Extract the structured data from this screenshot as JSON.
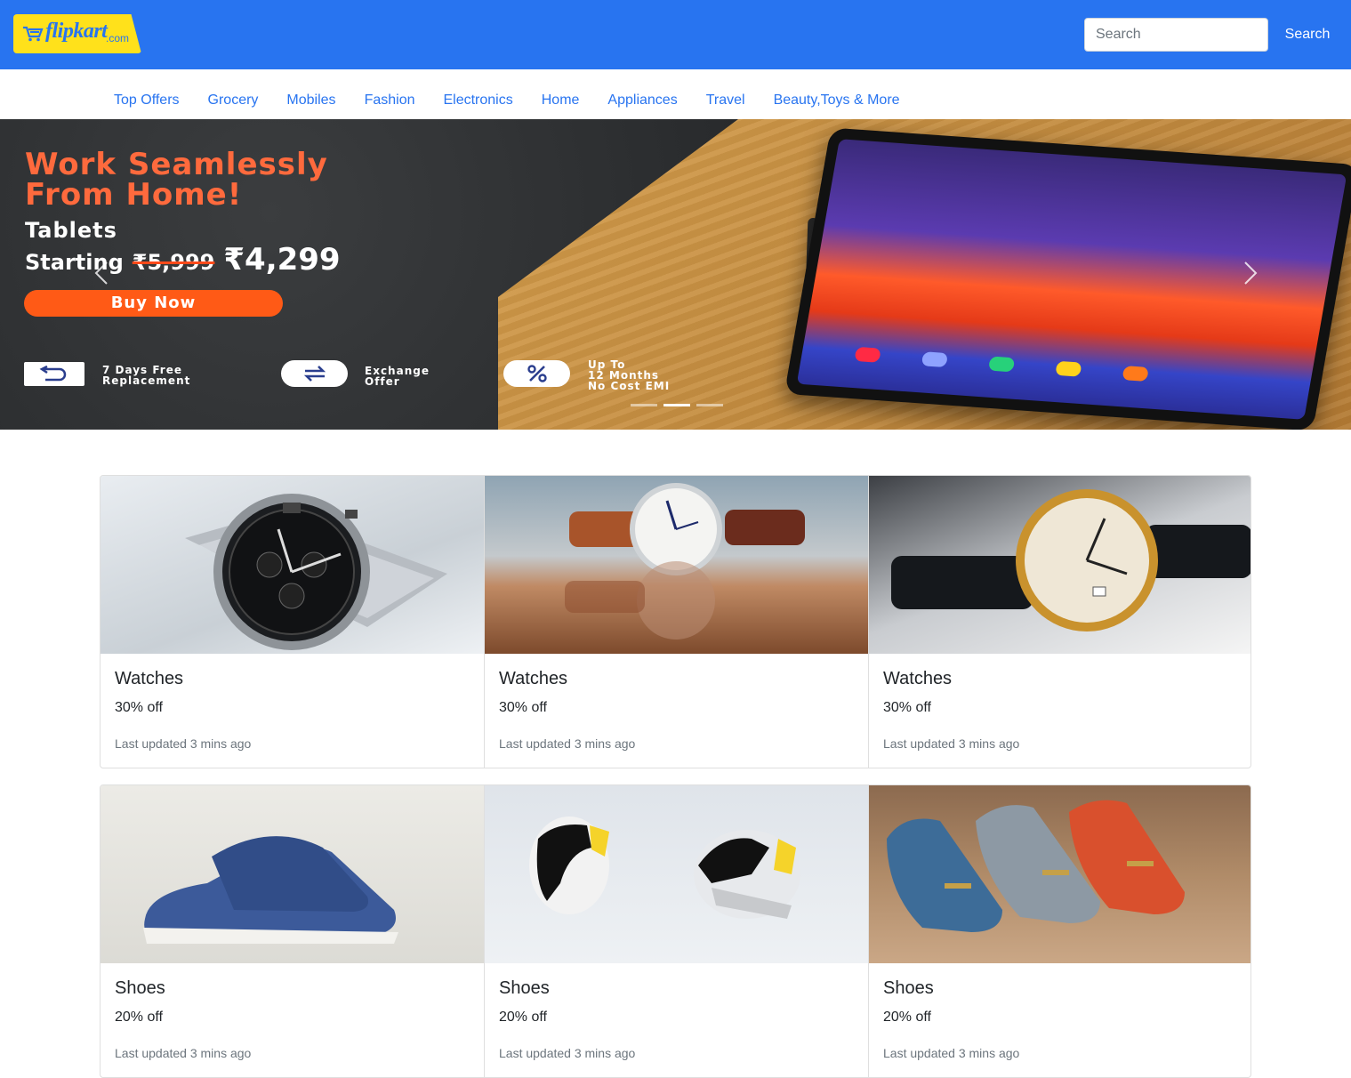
{
  "header": {
    "logo_text": "flipkart",
    "logo_suffix": ".com",
    "search_placeholder": "Search",
    "search_button": "Search",
    "colors": {
      "brand_blue": "#2874f0",
      "logo_yellow": "#ffe11b"
    }
  },
  "nav": {
    "categories": [
      "Top Offers",
      "Grocery",
      "Mobiles",
      "Fashion",
      "Electronics",
      "Home",
      "Appliances",
      "Travel",
      "Beauty,Toys & More"
    ]
  },
  "banner": {
    "headline_line1": "Work Seamlessly",
    "headline_line2": "From Home!",
    "product": "Tablets",
    "starting_label": "Starting",
    "old_price": "₹5,999",
    "new_price": "₹4,299",
    "cta": "Buy Now",
    "features": [
      {
        "icon": "return-icon",
        "line1": "7 Days Free",
        "line2": "Replacement"
      },
      {
        "icon": "exchange-icon",
        "line1": "Exchange",
        "line2": "Offer"
      },
      {
        "icon": "percent-icon",
        "line1": "Up To",
        "line2": "12 Months",
        "line3": "No Cost EMI"
      }
    ],
    "slides_total": 3,
    "active_slide": 2
  },
  "product_groups": [
    {
      "cards": [
        {
          "title": "Watches",
          "discount": "30% off",
          "updated": "Last updated 3 mins ago",
          "image": "black-chronograph-watch"
        },
        {
          "title": "Watches",
          "discount": "30% off",
          "updated": "Last updated 3 mins ago",
          "image": "white-dial-leather-watch"
        },
        {
          "title": "Watches",
          "discount": "30% off",
          "updated": "Last updated 3 mins ago",
          "image": "gold-roman-numeral-watch"
        }
      ]
    },
    {
      "cards": [
        {
          "title": "Shoes",
          "discount": "20% off",
          "updated": "Last updated 3 mins ago",
          "image": "blue-canvas-sneaker"
        },
        {
          "title": "Shoes",
          "discount": "20% off",
          "updated": "Last updated 3 mins ago",
          "image": "floating-sport-sneakers"
        },
        {
          "title": "Shoes",
          "discount": "20% off",
          "updated": "Last updated 3 mins ago",
          "image": "three-loafers"
        }
      ]
    }
  ]
}
